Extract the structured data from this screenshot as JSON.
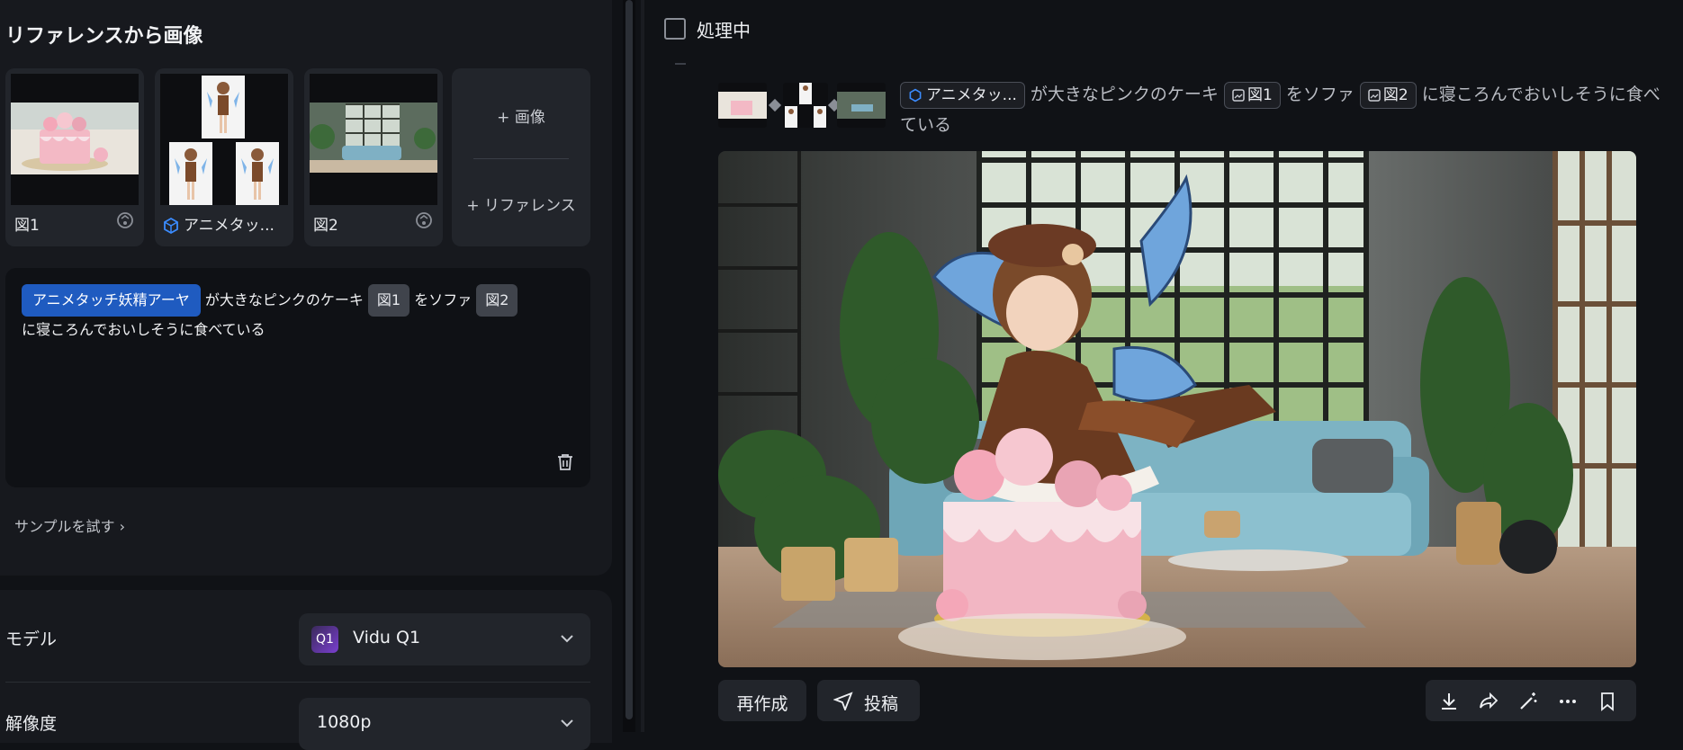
{
  "left": {
    "title": "リファレンスから画像",
    "refs": [
      {
        "label": "図1"
      },
      {
        "label": "アニメタッ..."
      },
      {
        "label": "図2"
      }
    ],
    "add_image": "+ 画像",
    "add_reference": "+ リファレンス",
    "prompt": {
      "chip_character": "アニメタッチ妖精アーヤ",
      "text1": " が大きなピンクのケーキ ",
      "chip_fig1": "図1",
      "text2": " をソファ ",
      "chip_fig2": "図2",
      "text3": "に寝ころんでおいしそうに食べている"
    },
    "sample_link": "サンプルを試す ›",
    "settings": {
      "model_label": "モデル",
      "model_value": "Vidu Q1",
      "model_badge": "Q1",
      "resolution_label": "解像度",
      "resolution_value": "1080p"
    }
  },
  "right": {
    "status": "処理中",
    "prompt": {
      "chip_character": "アニメタッ...",
      "text1": " が大きなピンクのケーキ ",
      "chip_fig1": "図1",
      "text2": " をソファ ",
      "chip_fig2": "図2",
      "text3": " に寝ころんでおいしそうに食べている"
    },
    "buttons": {
      "regenerate": "再作成",
      "post": "投稿"
    }
  },
  "colors": {
    "accent_blue": "#1f5bc0",
    "panel_bg": "#17191e",
    "page_bg": "#101216"
  }
}
